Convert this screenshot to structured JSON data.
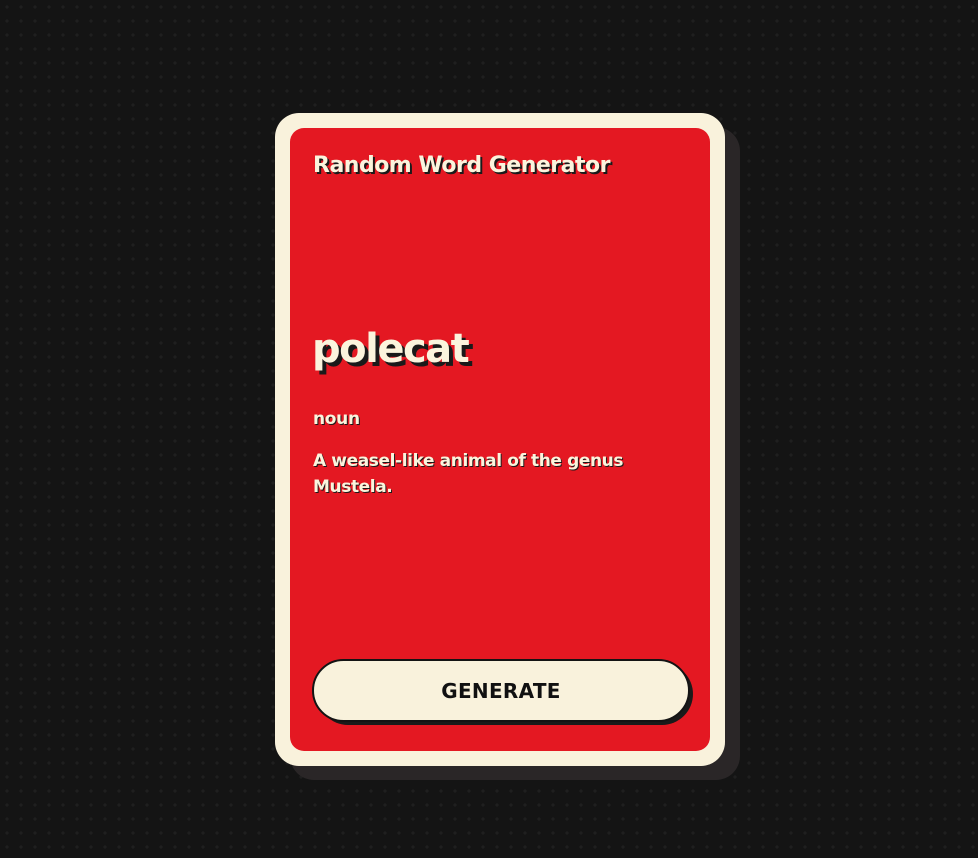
{
  "app": {
    "title": "Random Word Generator"
  },
  "entry": {
    "word": "polecat",
    "part_of_speech": "noun",
    "definition": "A weasel-like animal of the genus Mustela."
  },
  "actions": {
    "generate_label": "GENERATE"
  },
  "colors": {
    "background": "#141414",
    "card_frame": "#f9f2dc",
    "card_face": "#e41822",
    "text_light": "#fbf4dd",
    "text_dark": "#111111"
  }
}
